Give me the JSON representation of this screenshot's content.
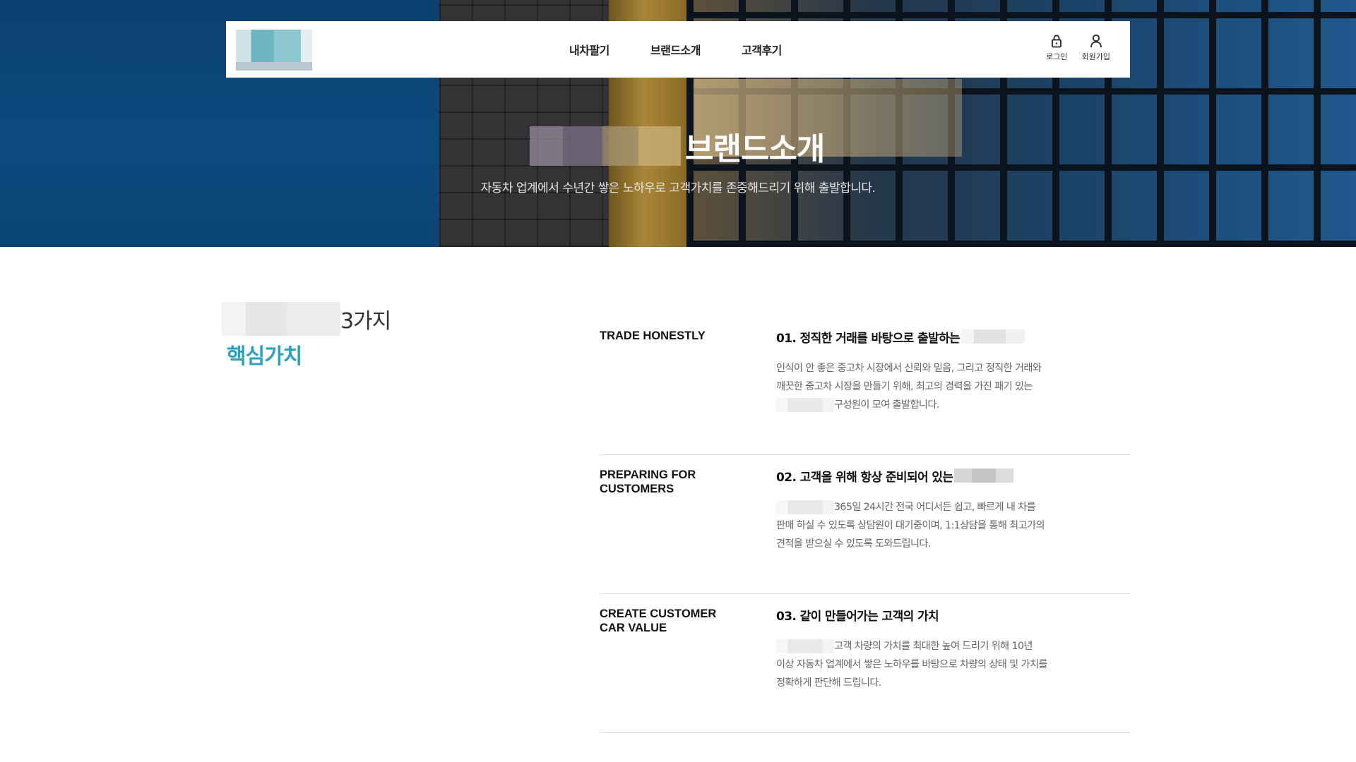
{
  "hero": {
    "title": "브랜드소개",
    "subtitle": "자동차 업계에서 수년간 쌓은 노하우로 고객가치를 존중해드리기 위해 출발합니다."
  },
  "nav": {
    "items": [
      {
        "label": "내차팔기"
      },
      {
        "label": "브랜드소개"
      },
      {
        "label": "고객후기"
      }
    ]
  },
  "util": {
    "login_label": "로그인",
    "signup_label": "회원가입",
    "login_icon": "lock-icon",
    "signup_icon": "user-icon"
  },
  "intro": {
    "count_text": "3가지",
    "core_text": "핵심가치"
  },
  "values": [
    {
      "en": "TRADE HONESTLY",
      "title": "01. 정직한 거래를 바탕으로 출발하는",
      "desc_lines": [
        "인식이 안 좋은 중고차 시장에서 신뢰와 믿음, 그리고 정직한 거래와",
        "깨끗한 중고차 시장을 만들기 위해, 최고의 경력을 가진 패기 있는",
        "구성원이 모여 출발합니다."
      ]
    },
    {
      "en_line1": "PREPARING FOR",
      "en_line2": "CUSTOMERS",
      "title": "02. 고객을 위해 항상 준비되어 있는",
      "desc_lines": [
        "365일 24시간 전국 어디서든 쉽고, 빠르게 내 차를",
        "판매 하실 수 있도록 상담원이 대기중이며, 1:1상담을 통해 최고가의",
        "견적을 받으실 수 있도록 도와드립니다."
      ]
    },
    {
      "en_line1": "CREATE CUSTOMER",
      "en_line2": "CAR VALUE",
      "title": "03. 같이 만들어가는 고객의 가치",
      "desc_lines": [
        "고객 차량의 가치를 최대한 높여 드리기 위해 10년",
        "이상 자동차 업계에서 쌓은 노하우를 바탕으로 차량의 상태 및 가치를",
        "정확하게 판단해 드립니다."
      ]
    }
  ],
  "colors": {
    "accent": "#2aa2c0",
    "header_bg": "#ffffff",
    "divider": "#dcdcdc"
  }
}
